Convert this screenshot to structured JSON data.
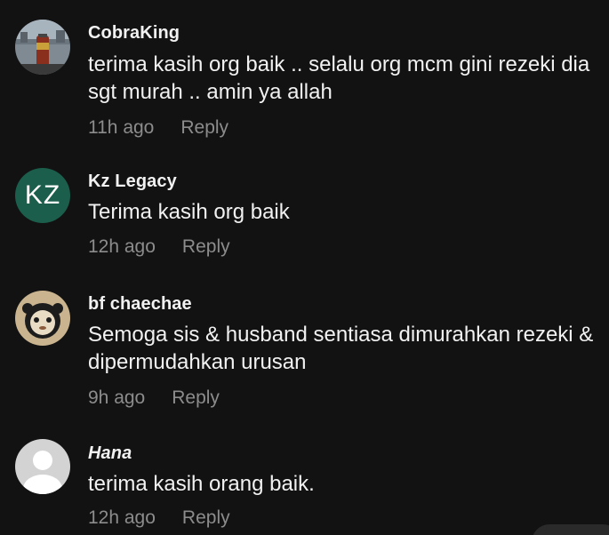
{
  "comments": [
    {
      "author": "CobraKing",
      "text": "terima kasih org baik .. selalu org mcm gini rezeki dia sgt murah .. amin ya allah",
      "time": "11h ago",
      "reply": "Reply",
      "avatar": "photo-avatar"
    },
    {
      "author": "Kz Legacy",
      "text": "Terima kasih org baik",
      "time": "12h ago",
      "reply": "Reply",
      "avatar_initials": "KZ",
      "avatar_color": "#1b5e4b"
    },
    {
      "author": "bf chaechae",
      "text": "Semoga sis & husband sentiasa dimurahkan rezeki & dipermudahkan urusan",
      "time": "9h ago",
      "reply": "Reply",
      "avatar": "cartoon-avatar"
    },
    {
      "author": "Hana",
      "text": "terima kasih orang baik.",
      "time": "12h ago",
      "reply": "Reply",
      "avatar": "default-user-avatar"
    }
  ]
}
